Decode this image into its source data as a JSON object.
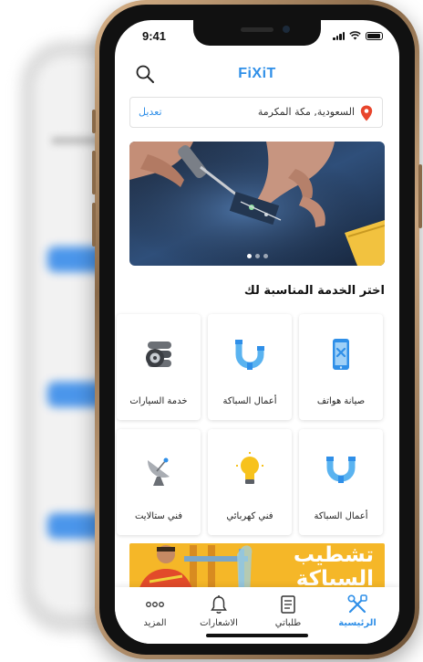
{
  "colors": {
    "accent": "#2f8fe8",
    "promo": "#f5b728"
  },
  "status_bar": {
    "time": "9:41"
  },
  "header": {
    "logo": "FiXiT",
    "search_icon": "search-icon"
  },
  "location": {
    "text": "السعودية, مكة المكرمة",
    "edit_label": "تعديل",
    "icon": "location-pin-icon"
  },
  "banner": {
    "slides": 3,
    "active_slide": 1
  },
  "section": {
    "title": "اختر الخدمة المناسبة لك"
  },
  "services": [
    {
      "label": "صيانة هواتف",
      "icon": "phone-repair-icon"
    },
    {
      "label": "أعمال السباكة",
      "icon": "plumbing-pipe-icon"
    },
    {
      "label": "خدمة السيارات",
      "icon": "car-tire-icon"
    },
    {
      "label": "أعمال السباكة",
      "icon": "plumbing-pipe-icon"
    },
    {
      "label": "فني كهربائي",
      "icon": "light-bulb-icon"
    },
    {
      "label": "فني ستالايت",
      "icon": "satellite-dish-icon"
    }
  ],
  "promo": {
    "line1": "تشطيب",
    "line2": "السباكة"
  },
  "tabs": [
    {
      "label": "الرئيسية",
      "icon": "tools-icon",
      "active": true
    },
    {
      "label": "طلباتي",
      "icon": "orders-icon",
      "active": false
    },
    {
      "label": "الاشعارات",
      "icon": "bell-icon",
      "active": false
    },
    {
      "label": "المزيد",
      "icon": "more-icon",
      "active": false
    }
  ]
}
